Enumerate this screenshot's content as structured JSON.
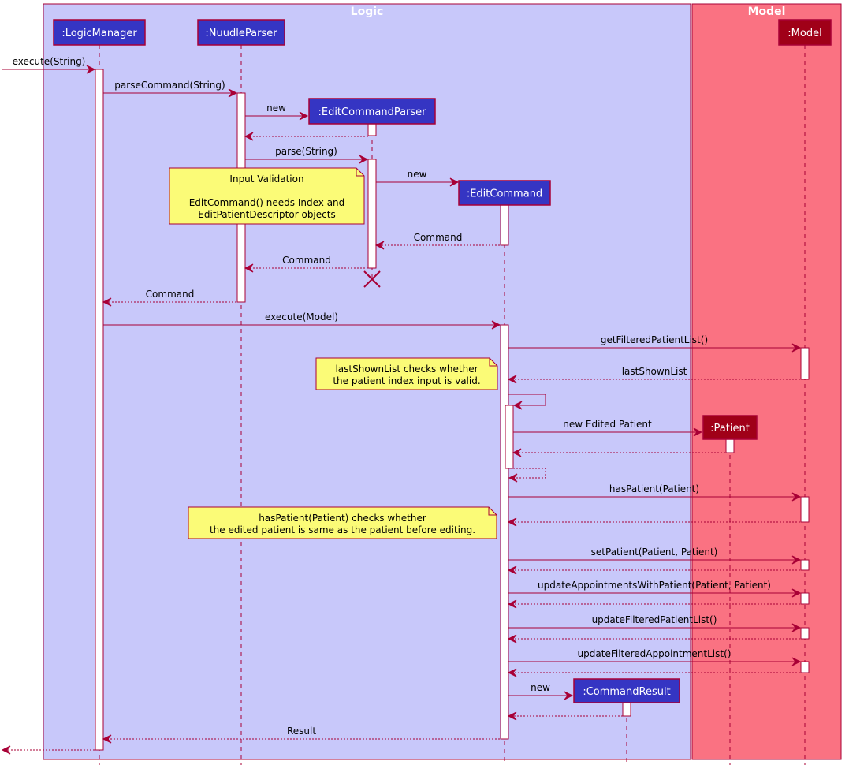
{
  "colors": {
    "logic_bg": "#c8c8fa",
    "model_bg": "#fa7282",
    "border": "#a80036",
    "logic_participant": "#3535c3",
    "model_participant": "#a00018",
    "note_bg": "#fbfb77",
    "activation": "#ffffff"
  },
  "frames": [
    {
      "title": "Logic"
    },
    {
      "title": "Model"
    }
  ],
  "participants": [
    {
      "id": "lm",
      "label": ":LogicManager",
      "group": "logic"
    },
    {
      "id": "np",
      "label": ":NuudleParser",
      "group": "logic"
    },
    {
      "id": "ecp",
      "label": ":EditCommandParser",
      "group": "logic"
    },
    {
      "id": "ec",
      "label": ":EditCommand",
      "group": "logic"
    },
    {
      "id": "cr",
      "label": ":CommandResult",
      "group": "logic"
    },
    {
      "id": "pt",
      "label": ":Patient",
      "group": "model"
    },
    {
      "id": "md",
      "label": ":Model",
      "group": "model"
    }
  ],
  "messages": [
    {
      "from": "external",
      "to": "lm",
      "label": "execute(String)",
      "type": "call"
    },
    {
      "from": "lm",
      "to": "np",
      "label": "parseCommand(String)",
      "type": "call"
    },
    {
      "from": "np",
      "to": "ecp",
      "label": "new",
      "type": "create"
    },
    {
      "from": "ecp",
      "to": "np",
      "label": "",
      "type": "return"
    },
    {
      "from": "np",
      "to": "ecp",
      "label": "parse(String)",
      "type": "call"
    },
    {
      "from": "ecp",
      "to": "ec",
      "label": "new",
      "type": "create"
    },
    {
      "from": "ec",
      "to": "ecp",
      "label": "Command",
      "type": "return"
    },
    {
      "from": "ecp",
      "to": "np",
      "label": "Command",
      "type": "return"
    },
    {
      "from": "np",
      "to": "lm",
      "label": "Command",
      "type": "return"
    },
    {
      "from": "lm",
      "to": "ec",
      "label": "execute(Model)",
      "type": "call"
    },
    {
      "from": "ec",
      "to": "md",
      "label": "getFilteredPatientList()",
      "type": "call"
    },
    {
      "from": "md",
      "to": "ec",
      "label": "lastShownList",
      "type": "return"
    },
    {
      "from": "ec",
      "to": "ec",
      "label": "",
      "type": "self-call"
    },
    {
      "from": "ec",
      "to": "pt",
      "label": "new Edited Patient",
      "type": "create"
    },
    {
      "from": "pt",
      "to": "ec",
      "label": "",
      "type": "return"
    },
    {
      "from": "ec",
      "to": "ec",
      "label": "",
      "type": "self-return"
    },
    {
      "from": "ec",
      "to": "md",
      "label": "hasPatient(Patient)",
      "type": "call"
    },
    {
      "from": "md",
      "to": "ec",
      "label": "",
      "type": "return"
    },
    {
      "from": "ec",
      "to": "md",
      "label": "setPatient(Patient, Patient)",
      "type": "call"
    },
    {
      "from": "md",
      "to": "ec",
      "label": "",
      "type": "return"
    },
    {
      "from": "ec",
      "to": "md",
      "label": "updateAppointmentsWithPatient(Patient, Patient)",
      "type": "call"
    },
    {
      "from": "md",
      "to": "ec",
      "label": "",
      "type": "return"
    },
    {
      "from": "ec",
      "to": "md",
      "label": "updateFilteredPatientList()",
      "type": "call"
    },
    {
      "from": "md",
      "to": "ec",
      "label": "",
      "type": "return"
    },
    {
      "from": "ec",
      "to": "md",
      "label": "updateFilteredAppointmentList()",
      "type": "call"
    },
    {
      "from": "md",
      "to": "ec",
      "label": "",
      "type": "return"
    },
    {
      "from": "ec",
      "to": "cr",
      "label": "new",
      "type": "create"
    },
    {
      "from": "cr",
      "to": "ec",
      "label": "",
      "type": "return"
    },
    {
      "from": "ec",
      "to": "lm",
      "label": "Result",
      "type": "return"
    },
    {
      "from": "lm",
      "to": "external",
      "label": "",
      "type": "return"
    }
  ],
  "notes": [
    {
      "lines": [
        "Input Validation",
        "",
        "EditCommand() needs Index and",
        "EditPatientDescriptor objects"
      ]
    },
    {
      "lines": [
        "lastShownList checks whether",
        "the patient index input is valid."
      ]
    },
    {
      "lines": [
        "hasPatient(Patient) checks whether",
        "the edited patient is same as the patient before editing."
      ]
    }
  ],
  "destroyed": [
    "ecp"
  ]
}
